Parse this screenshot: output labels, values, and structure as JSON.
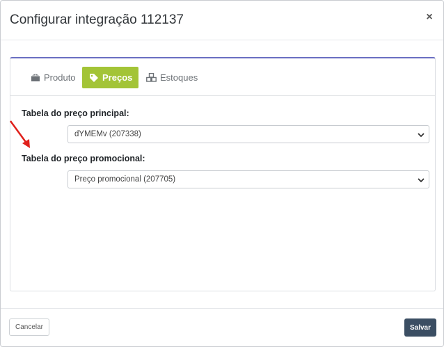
{
  "modal": {
    "title": "Configurar integração 112137",
    "close_glyph": "×"
  },
  "tabs": [
    {
      "label": "Produto",
      "icon": "box-icon",
      "active": false
    },
    {
      "label": "Preços",
      "icon": "tag-icon",
      "active": true
    },
    {
      "label": "Estoques",
      "icon": "cubes-icon",
      "active": false
    }
  ],
  "form": {
    "principal_label": "Tabela do preço principal:",
    "principal_value": "dYMEMv (207338)",
    "promocional_label": "Tabela do preço promocional:",
    "promocional_value": "Preço promocional (207705)"
  },
  "footer": {
    "cancel_label": "Cancelar",
    "save_label": "Salvar"
  },
  "colors": {
    "active_tab": "#a3c437",
    "card_top_border": "#6a6fc2",
    "save_button": "#3b4e63",
    "annotation_arrow": "#e0201b"
  }
}
